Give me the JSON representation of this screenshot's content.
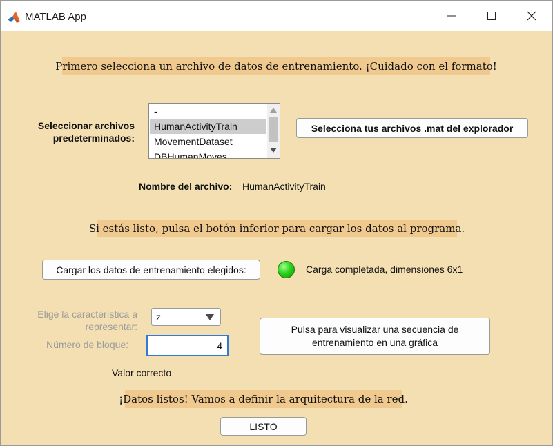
{
  "window": {
    "title": "MATLAB App",
    "icon": "matlab-logo-icon",
    "controls": [
      "minimize-icon",
      "maximize-icon",
      "close-icon"
    ]
  },
  "banners": {
    "select_file": "Primero selecciona un archivo de datos de entrenamiento. ¡Cuidado con el formato!",
    "ready_to_load": "Si estás listo, pulsa el botón inferior para cargar los datos al programa.",
    "data_ready": "¡Datos listos! Vamos a definir la arquitectura de la red."
  },
  "preset_files": {
    "label": "Seleccionar archivos predeterminados:",
    "items": [
      "-",
      "HumanActivityTrain",
      "MovementDataset",
      "DBHumanMoves"
    ],
    "selected": "HumanActivityTrain"
  },
  "explorer_button": "Selecciona tus archivos .mat del explorador",
  "filename": {
    "label": "Nombre del archivo:",
    "value": "HumanActivityTrain"
  },
  "load": {
    "button": "Cargar los datos de entrenamiento elegidos:",
    "status": "Carga completada, dimensiones 6x1",
    "lamp_color": "#2fd21c"
  },
  "feature": {
    "label": "Elige la característica a representar:",
    "value": "z"
  },
  "block": {
    "label": "Número de bloque:",
    "value": "4",
    "validation": "Valor correcto"
  },
  "plot_button": "Pulsa para visualizar una secuencia de entrenamiento en una gráfica",
  "ready_button": "LISTO",
  "colors": {
    "background": "#f3dfb1",
    "banner": "#efc98e",
    "input_focus": "#2f7bd6"
  }
}
